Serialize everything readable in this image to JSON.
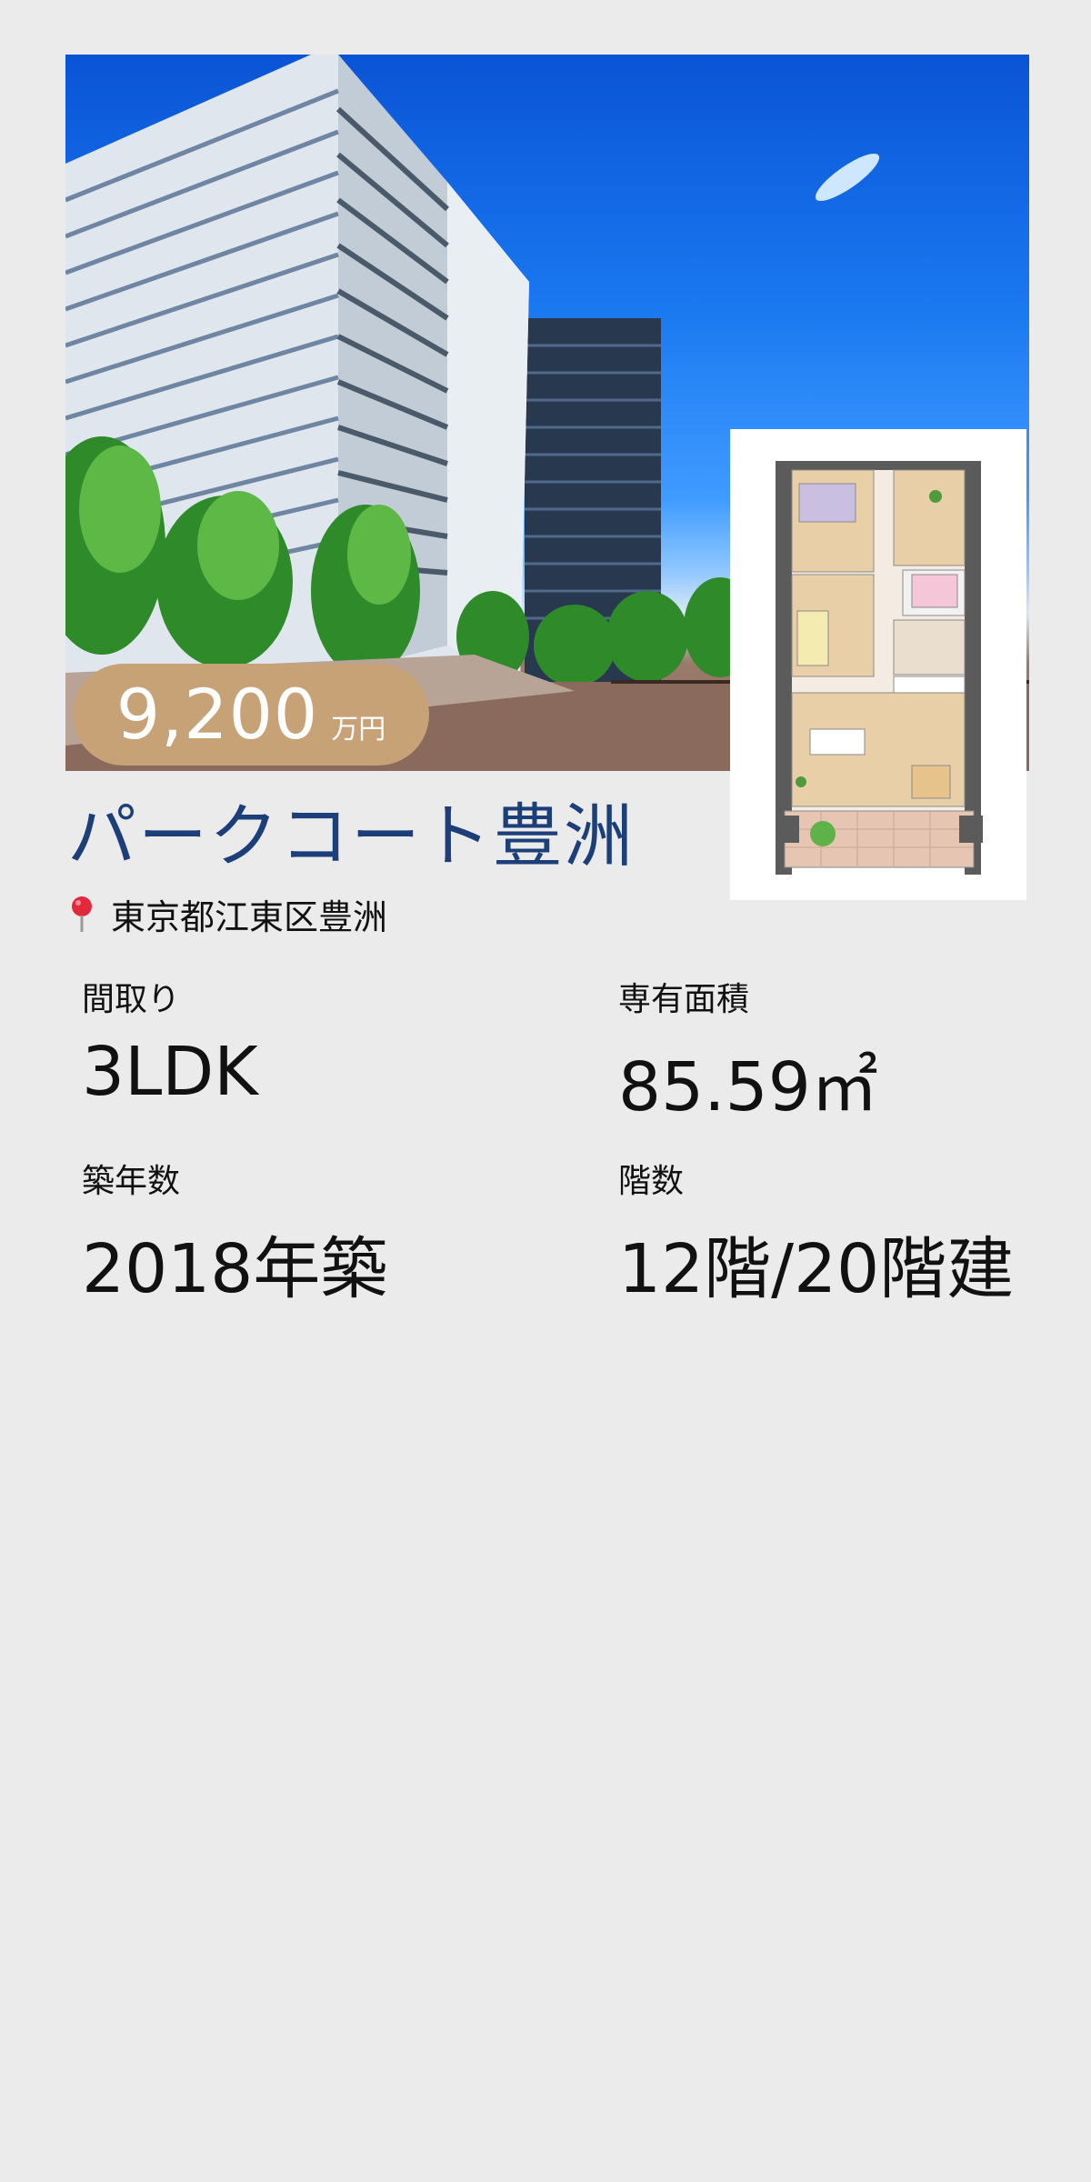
{
  "listing": {
    "price_value": "9,200",
    "price_unit": "万円",
    "name": "パークコート豊洲",
    "address": "東京都江東区豊洲",
    "specs": [
      {
        "label": "間取り",
        "value": "3LDK"
      },
      {
        "label": "専有面積",
        "value": "85.59㎡"
      },
      {
        "label": "築年数",
        "value": "2018年築"
      },
      {
        "label": "階数",
        "value": "12階/20階建"
      }
    ]
  },
  "icons": {
    "location": "map-pin-icon"
  },
  "colors": {
    "title": "#1c3f7a",
    "price_badge": "#c8a277",
    "background": "#ebebeb",
    "pin": "#e2283c"
  }
}
